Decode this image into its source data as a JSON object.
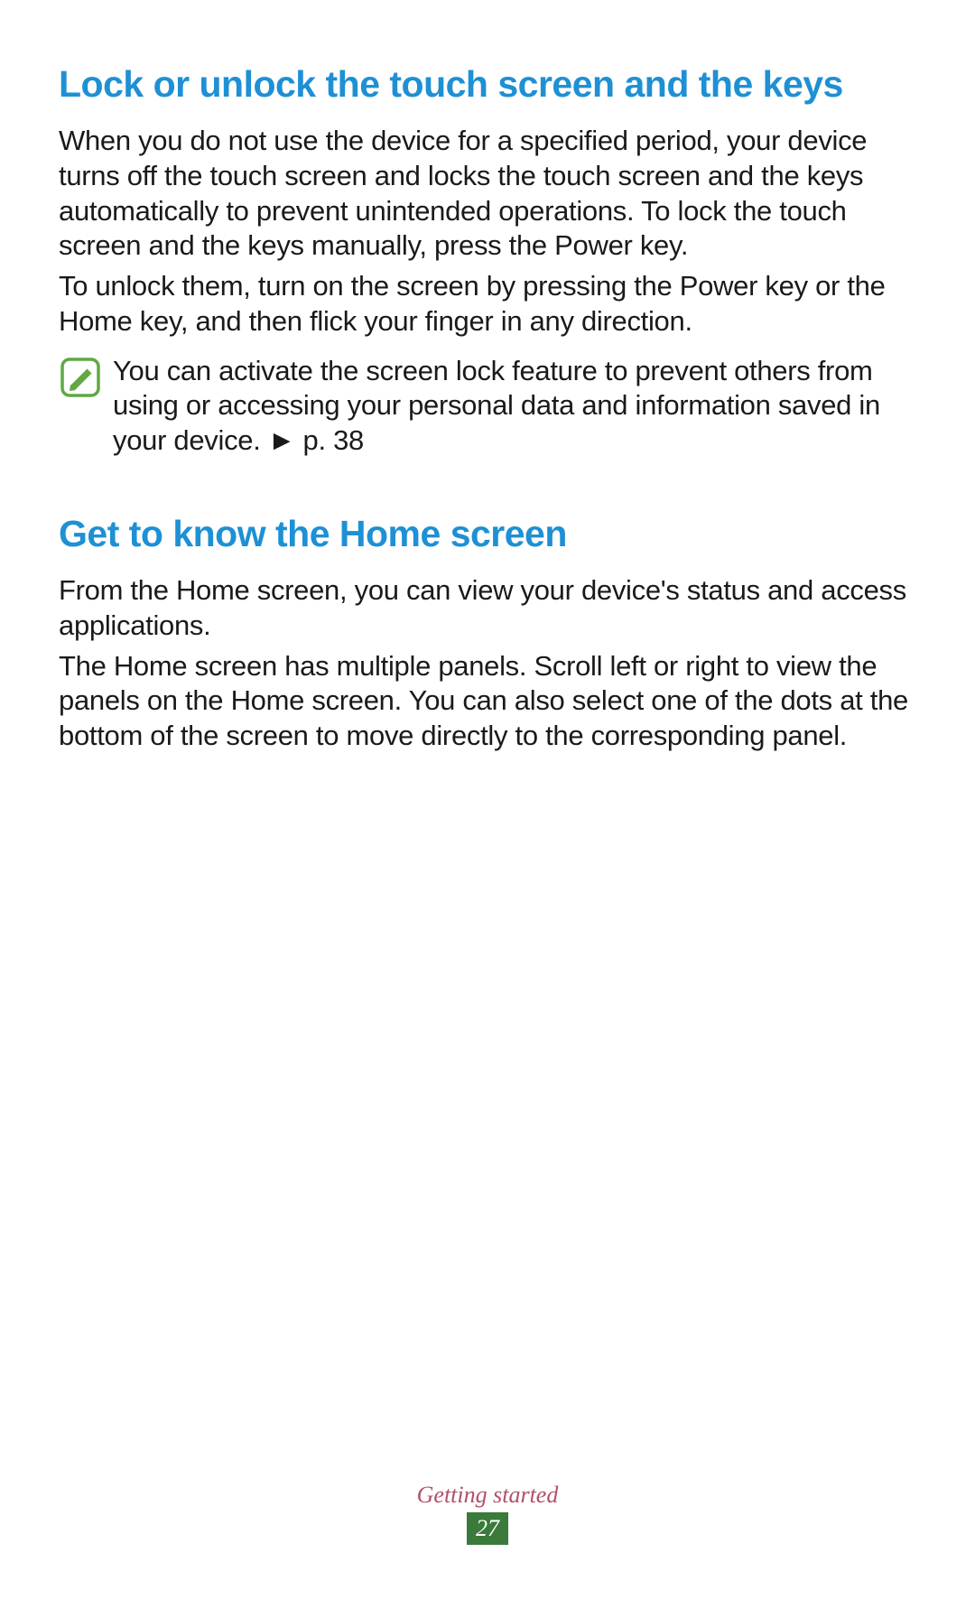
{
  "section1": {
    "heading": "Lock or unlock the touch screen and the keys",
    "para1": "When you do not use the device for a specified period, your device turns off the touch screen and locks the touch screen and the keys automatically to prevent unintended operations. To lock the touch screen and the keys manually, press the Power key.",
    "para2": "To unlock them, turn on the screen by pressing the Power key or the Home key, and then flick your finger in any direction.",
    "note_text": "You can activate the screen lock feature to prevent others from using or accessing your personal data and information saved in your device. ",
    "note_ref": "► p. 38"
  },
  "section2": {
    "heading": "Get to know the Home screen",
    "para1": "From the Home screen, you can view your device's status and access applications.",
    "para2": "The Home screen has multiple panels. Scroll left or right to view the panels on the Home screen. You can also select one of the dots at the bottom of the screen to move directly to the corresponding panel."
  },
  "footer": {
    "section_name": "Getting started",
    "page_number": "27"
  }
}
